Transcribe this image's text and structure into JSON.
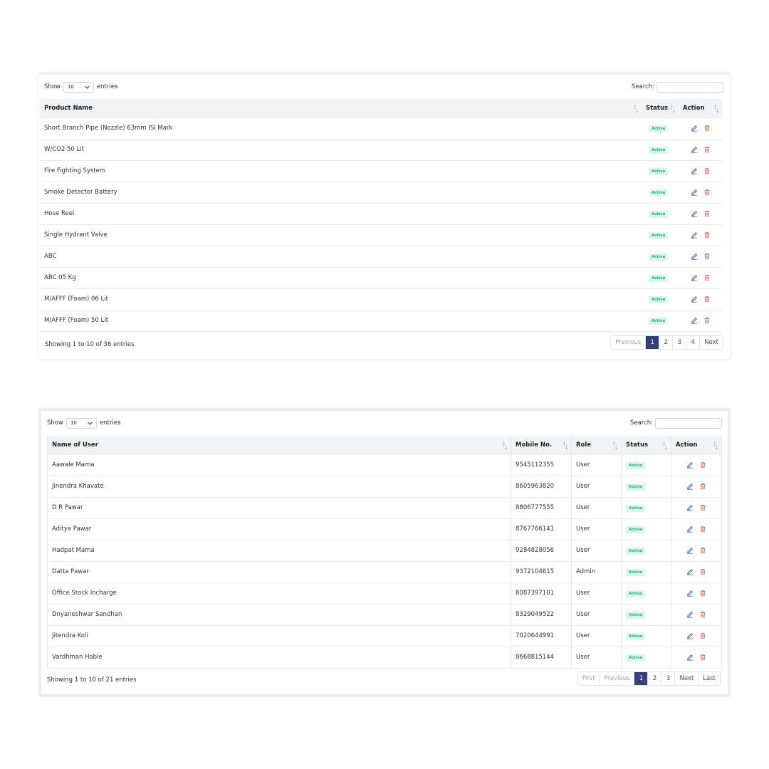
{
  "products_table": {
    "show_label": "Show",
    "entries_label": "entries",
    "page_size": "10",
    "search_label": "Search:",
    "search_value": "",
    "columns": [
      "Product Name",
      "Status",
      "Action"
    ],
    "rows": [
      {
        "name": "Short Branch Pipe (Nozzle) 63mm ISI Mark",
        "status": "Active"
      },
      {
        "name": "W/CO2 50 Lit",
        "status": "Active"
      },
      {
        "name": "Fire Fighting System",
        "status": "Active"
      },
      {
        "name": "Smoke Detector Battery",
        "status": "Active"
      },
      {
        "name": "Hose Reel",
        "status": "Active"
      },
      {
        "name": "Single Hydrant Valve",
        "status": "Active"
      },
      {
        "name": "ABC",
        "status": "Active"
      },
      {
        "name": "ABC 05 Kg",
        "status": "Active"
      },
      {
        "name": "M/AFFF (Foam) 06 Lit",
        "status": "Active"
      },
      {
        "name": "M/AFFF (Foam) 50 Lit",
        "status": "Active"
      }
    ],
    "info": "Showing 1 to 10 of 36 entries",
    "pagination": [
      "Previous",
      "1",
      "2",
      "3",
      "4",
      "Next"
    ],
    "current_page": "1"
  },
  "users_table": {
    "show_label": "Show",
    "entries_label": "entries",
    "page_size": "10",
    "search_label": "Search:",
    "search_value": "",
    "columns": [
      "Name of User",
      "Mobile No.",
      "Role",
      "Status",
      "Action"
    ],
    "rows": [
      {
        "name": "Aawale Mama",
        "mobile": "9545112355",
        "role": "User",
        "status": "Active"
      },
      {
        "name": "Jinendra Khavate",
        "mobile": "8605963820",
        "role": "User",
        "status": "Active"
      },
      {
        "name": "D R Pawar",
        "mobile": "8806777555",
        "role": "User",
        "status": "Active"
      },
      {
        "name": "Aditya Pawar",
        "mobile": "8767766141",
        "role": "User",
        "status": "Active"
      },
      {
        "name": "Hadpat Mama",
        "mobile": "9284828056",
        "role": "User",
        "status": "Active"
      },
      {
        "name": "Datta Pawar",
        "mobile": "9372104615",
        "role": "Admin",
        "status": "Active"
      },
      {
        "name": "Office Stock Incharge",
        "mobile": "8087397101",
        "role": "User",
        "status": "Active"
      },
      {
        "name": "Dnyaneshwar Sandhan",
        "mobile": "8329049522",
        "role": "User",
        "status": "Active"
      },
      {
        "name": "Jitendra Koli",
        "mobile": "7020644991",
        "role": "User",
        "status": "Active"
      },
      {
        "name": "Vardhman Hable",
        "mobile": "8668815144",
        "role": "User",
        "status": "Active"
      }
    ],
    "info": "Showing 1 to 10 of 21 entries",
    "pagination": [
      "First",
      "Previous",
      "1",
      "2",
      "3",
      "Next",
      "Last"
    ],
    "current_page": "1"
  },
  "icons": {
    "edit": "edit-icon",
    "delete": "trash-icon",
    "sort": "sort-icon",
    "dropdown": "chevron-down-icon"
  },
  "colors": {
    "accent": "#34407a",
    "badge_bg": "#d9f6ee",
    "badge_text": "#1aaf86",
    "edit_icon": "#3b4b8c",
    "delete_icon": "#e05a4f",
    "header_bg": "#f1f5f8"
  }
}
